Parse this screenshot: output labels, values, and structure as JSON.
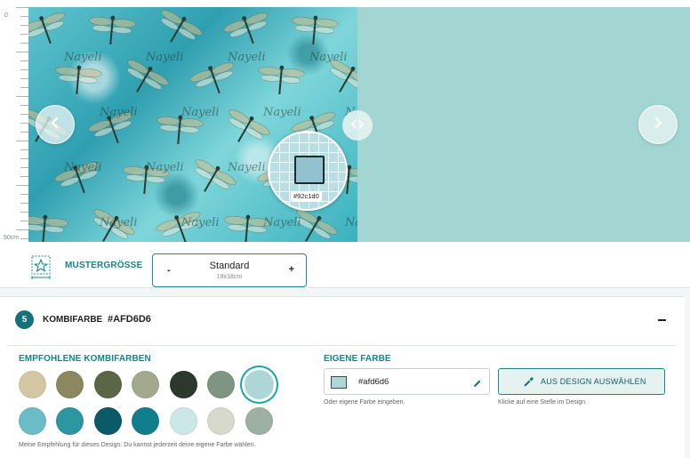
{
  "ruler": {
    "top_label": "0",
    "bottom_label": "50cm"
  },
  "loupe": {
    "hex": "#92c1d0",
    "color": "#92c1d0"
  },
  "pattern": {
    "watermark": "Nayeli",
    "base_color": "#3ab1bf",
    "fill_color": "#a3d6d2"
  },
  "size": {
    "label": "MUSTERGRÖSSE",
    "value": "Standard",
    "sub": "18x18cm",
    "minus": "-",
    "plus": "+"
  },
  "panel": {
    "step": "5",
    "title": "KOMBIFARBE",
    "hex": "#AFD6D6",
    "recommended_title": "EMPFOHLENE KOMBIFARBEN",
    "recommended_note": "Meine Empfehlung für dieses Design. Du kannst jederzeit deine eigene Farbe wählen.",
    "own_title": "EIGENE FARBE",
    "own_value": "#afd6d6",
    "own_hint": "Oder eigene Farbe eingeben.",
    "pick_label": "AUS DESIGN AUSWÄHLEN",
    "pick_hint": "Klicke auf eine Stelle im Design.",
    "selected_index": 6,
    "swatches": [
      "#d3c6a2",
      "#8b8760",
      "#5d6547",
      "#a3a98e",
      "#2c382b",
      "#7e9583",
      "#afd6d6",
      "#6bbcc7",
      "#2d96a1",
      "#0c5a67",
      "#117e8e",
      "#cbe7e6",
      "#d6d9cb",
      "#9eb0a3"
    ]
  },
  "icons": {
    "prev": "chevron-left-icon",
    "next": "chevron-right-icon",
    "split": "split-arrows-icon",
    "star": "star-icon",
    "pen": "pencil-icon",
    "eyedropper": "eyedropper-icon"
  }
}
